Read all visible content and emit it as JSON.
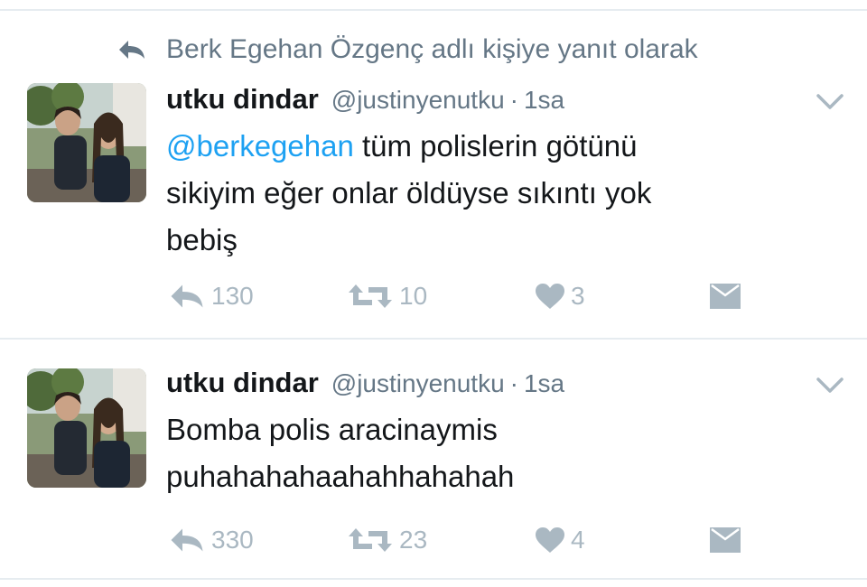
{
  "tweets": [
    {
      "reply_context": "Berk Egehan Özgenç adlı kişiye yanıt olarak",
      "name": "utku dindar",
      "handle": "@justinyenutku",
      "dot": "·",
      "time": "1sa",
      "mention": "@berkegehan",
      "text_line1": " tüm polislerin götünü",
      "text_line2": "sikiyim eğer onlar öldüyse sıkıntı yok",
      "text_line3": "bebiş",
      "reply_count": "130",
      "retweet_count": "10",
      "like_count": "3"
    },
    {
      "name": "utku dindar",
      "handle": "@justinyenutku",
      "dot": "·",
      "time": "1sa",
      "text_line1": "Bomba polis aracinaymis",
      "text_line2": "puhahahahaahahhahahah",
      "reply_count": "330",
      "retweet_count": "23",
      "like_count": "4"
    }
  ],
  "icons": {
    "reply": "reply-icon",
    "retweet": "retweet-icon",
    "like": "heart-icon",
    "message": "envelope-icon",
    "menu": "chevron-down-icon"
  },
  "colors": {
    "accent": "#1da1f2",
    "muted": "#657786",
    "icon": "#aab8c2",
    "divider": "#e6ecf0"
  }
}
